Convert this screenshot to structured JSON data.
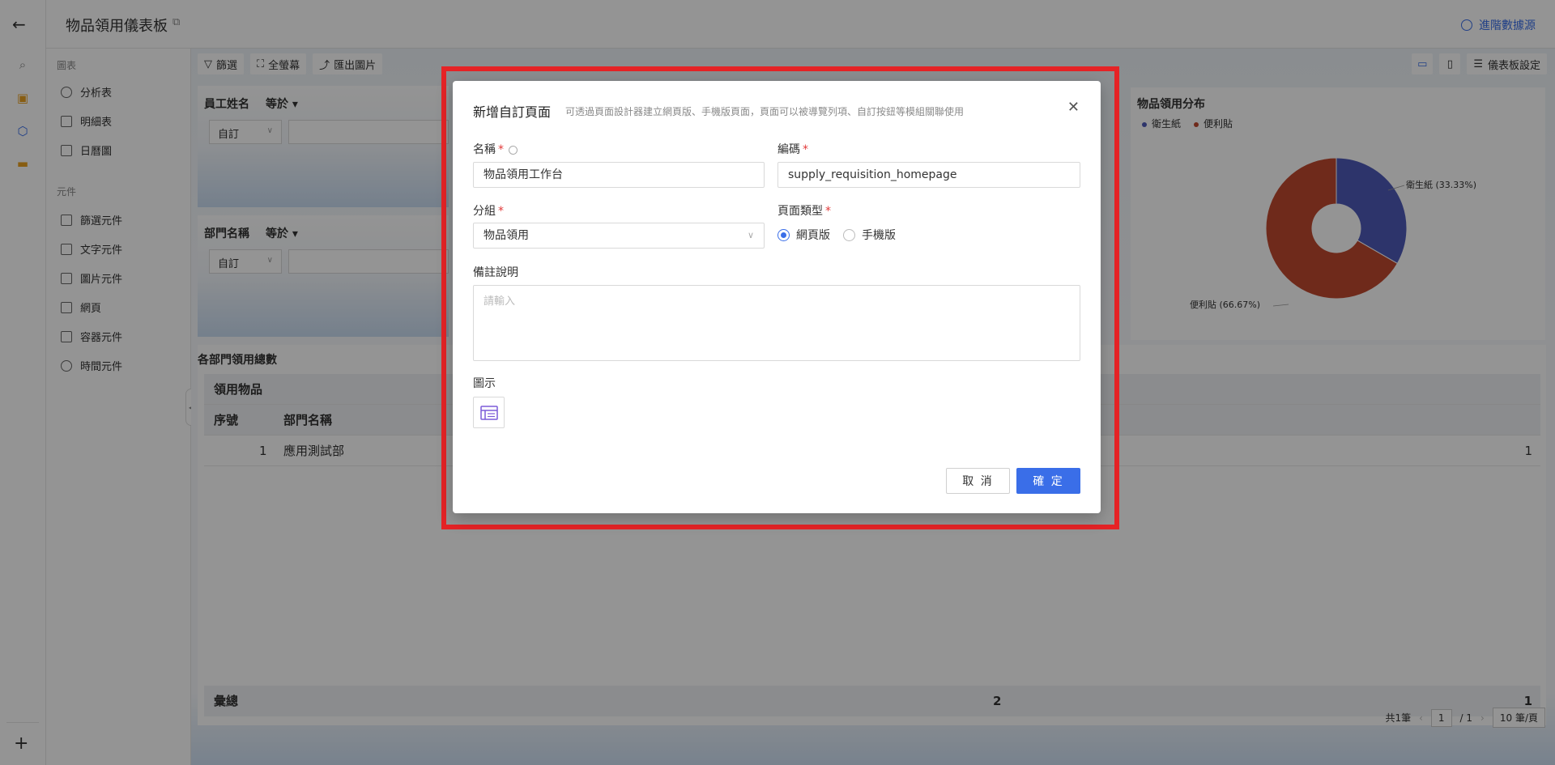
{
  "header": {
    "title": "物品領用儀表板",
    "advanced_source": "進階數據源"
  },
  "sidebar": {
    "group_charts": "圖表",
    "charts": [
      "分析表",
      "明細表",
      "日曆圖"
    ],
    "group_components": "元件",
    "components": [
      "篩選元件",
      "文字元件",
      "圖片元件",
      "網頁",
      "容器元件",
      "時間元件"
    ]
  },
  "toolbar": {
    "filter": "篩選",
    "fullscreen": "全螢幕",
    "export_image": "匯出圖片",
    "dashboard_settings": "儀表板設定"
  },
  "filters": [
    {
      "label": "員工姓名",
      "operator": "等於",
      "mode": "自訂"
    },
    {
      "label": "部門名稱",
      "operator": "等於",
      "mode": "自訂"
    }
  ],
  "pie": {
    "title": "物品領用分布",
    "legend": [
      "衛生紙",
      "便利貼"
    ],
    "labels": [
      "衛生紙 (33.33%)",
      "便利貼 (66.67%)"
    ]
  },
  "chart_data": {
    "type": "pie",
    "title": "物品領用分布",
    "categories": [
      "衛生紙",
      "便利貼"
    ],
    "values": [
      33.33,
      66.67
    ],
    "colors": [
      "#4f5bb8",
      "#c0492f"
    ],
    "legend": "top-left"
  },
  "table": {
    "title": "各部門領用總數",
    "group_header": "領用物品",
    "columns": [
      "序號",
      "部門名稱"
    ],
    "rows": [
      {
        "index": "1",
        "dept": "應用測試部",
        "last": "1"
      }
    ],
    "total_label": "彙總",
    "total_mid": "2",
    "total_last": "1"
  },
  "pager": {
    "total": "共1筆",
    "page": "1",
    "pages": "/ 1",
    "size": "10 筆/頁"
  },
  "modal": {
    "title": "新增自訂頁面",
    "subtitle": "可透過頁面設計器建立網頁版、手機版頁面，頁面可以被導覽列項、自訂按鈕等模組關聯使用",
    "name_label": "名稱",
    "name_value": "物品領用工作台",
    "code_label": "編碼",
    "code_value": "supply_requisition_homepage",
    "group_label": "分組",
    "group_value": "物品領用",
    "type_label": "頁面類型",
    "type_web": "網頁版",
    "type_mobile": "手機版",
    "remark_label": "備註說明",
    "remark_placeholder": "請輸入",
    "icon_label": "圖示",
    "cancel": "取 消",
    "ok": "確 定"
  },
  "colors": {
    "accent": "#3a6ee8",
    "highlight": "#e62326"
  }
}
